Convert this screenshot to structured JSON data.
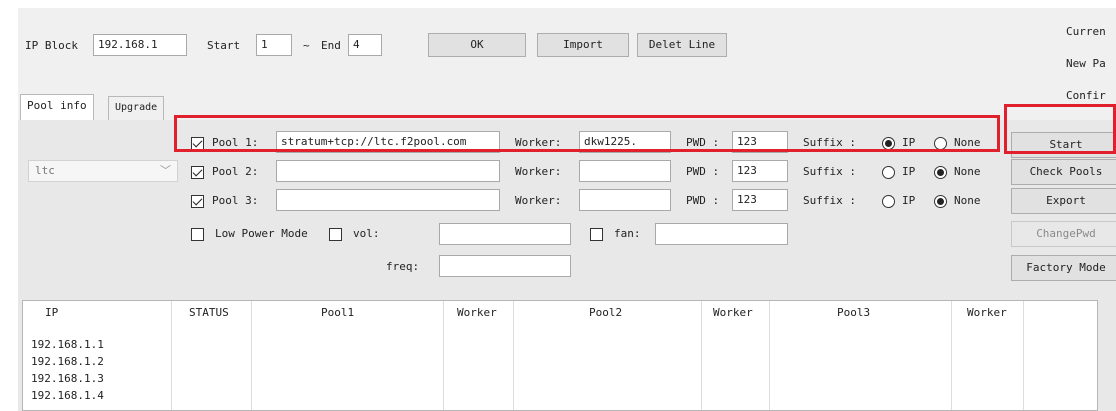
{
  "header": {
    "ip_block_label": "IP Block",
    "ip_block_value": "192.168.1",
    "start_label": "Start",
    "start_value": "1",
    "tilde": "~",
    "end_label": "End",
    "end_value": "4",
    "ok_label": "OK",
    "import_label": "Import",
    "delete_line_label": "Delet Line"
  },
  "right_labels": {
    "current": "Curren",
    "new_pass": "New Pa",
    "confirm": "Confir"
  },
  "tabs": [
    {
      "label": "Pool info"
    },
    {
      "label": "Upgrade"
    }
  ],
  "coin_select": {
    "value": "ltc"
  },
  "pools": [
    {
      "label": "Pool 1:",
      "url": "stratum+tcp://ltc.f2pool.com",
      "worker_label": "Worker:",
      "worker": "dkw1225.",
      "pwd_label": "PWD :",
      "pwd": "123",
      "suffix_label": "Suffix :",
      "ip_label": "IP",
      "none_label": "None",
      "suffix": "IP",
      "checked": true
    },
    {
      "label": "Pool 2:",
      "url": "",
      "worker_label": "Worker:",
      "worker": "",
      "pwd_label": "PWD :",
      "pwd": "123",
      "suffix_label": "Suffix :",
      "ip_label": "IP",
      "none_label": "None",
      "suffix": "None",
      "checked": true
    },
    {
      "label": "Pool 3:",
      "url": "",
      "worker_label": "Worker:",
      "worker": "",
      "pwd_label": "PWD :",
      "pwd": "123",
      "suffix_label": "Suffix :",
      "ip_label": "IP",
      "none_label": "None",
      "suffix": "None",
      "checked": true
    }
  ],
  "options": {
    "low_power_label": "Low Power Mode",
    "vol_label": "vol:",
    "fan_label": "fan:",
    "freq_label": "freq:"
  },
  "side_buttons": {
    "start": "Start",
    "check_pools": "Check Pools",
    "export": "Export",
    "change_pwd": "ChangePwd",
    "factory_mode": "Factory Mode"
  },
  "table": {
    "columns": [
      "IP",
      "STATUS",
      "Pool1",
      "Worker",
      "Pool2",
      "Worker",
      "Pool3",
      "Worker"
    ],
    "rows": [
      "192.168.1.1",
      "192.168.1.2",
      "192.168.1.3",
      "192.168.1.4"
    ]
  },
  "colors": {
    "highlight": "#e0202c"
  }
}
